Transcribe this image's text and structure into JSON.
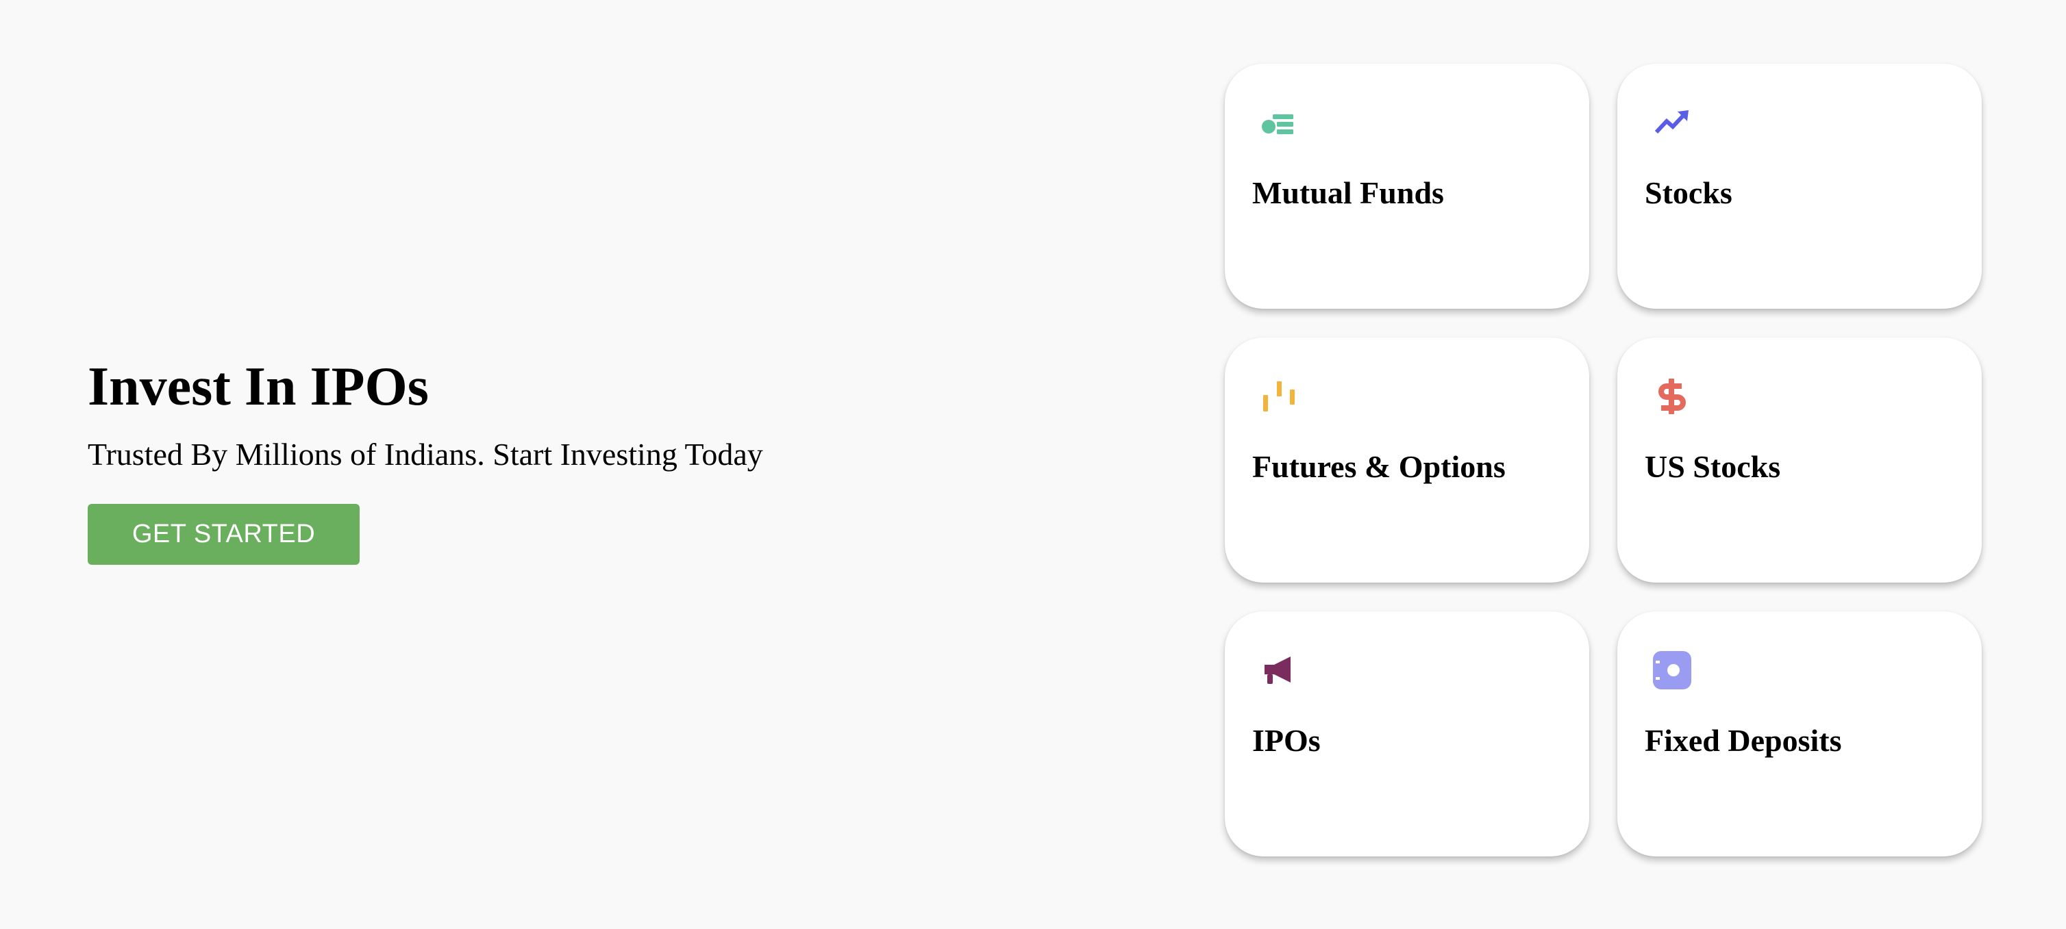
{
  "hero": {
    "title": "Invest In IPOs",
    "subtitle": "Trusted By Millions of Indians. Start Investing Today",
    "cta_label": "GET STARTED",
    "cta_color": "#6aaf5e"
  },
  "products": [
    {
      "label": "Mutual Funds",
      "icon": "mutual-funds-icon",
      "color": "#5fc4a0"
    },
    {
      "label": "Stocks",
      "icon": "trending-up-icon",
      "color": "#5a5ee6"
    },
    {
      "label": "Futures & Options",
      "icon": "candlestick-icon",
      "color": "#f2b43c"
    },
    {
      "label": "US Stocks",
      "icon": "dollar-icon",
      "color": "#e46a5e"
    },
    {
      "label": "IPOs",
      "icon": "megaphone-icon",
      "color": "#7a2c5e"
    },
    {
      "label": "Fixed Deposits",
      "icon": "safe-icon",
      "color": "#9a9cf2"
    }
  ]
}
